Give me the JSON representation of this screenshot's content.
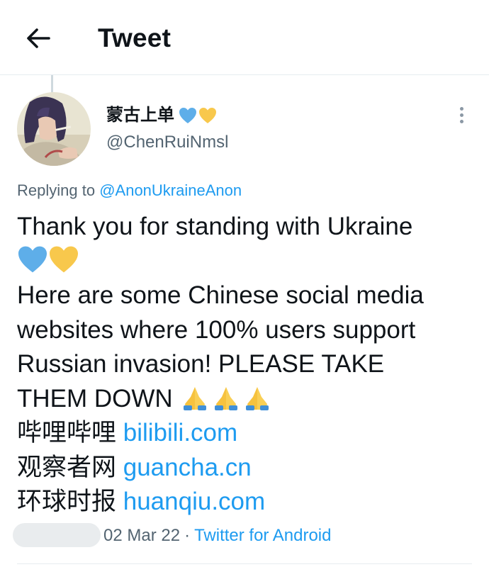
{
  "header": {
    "title": "Tweet",
    "back_icon": "arrow-left-icon"
  },
  "tweet": {
    "author": {
      "display_name": "蒙古上单",
      "name_emojis": [
        "blue-heart-icon",
        "yellow-heart-icon"
      ],
      "handle": "@ChenRuiNmsl"
    },
    "more_icon": "more-vertical-icon",
    "reply_prefix": "Replying to",
    "reply_mention": "@AnonUkraineAnon",
    "text_lines": [
      "Thank you for standing with Ukraine",
      "Here are some Chinese social media",
      "websites where 100% users support",
      "Russian invasion! PLEASE TAKE",
      "THEM DOWN"
    ],
    "line2_emojis": [
      "blue-heart-icon",
      "yellow-heart-icon"
    ],
    "line6_emojis": [
      "folded-hands-icon",
      "folded-hands-icon",
      "folded-hands-icon"
    ],
    "sites": [
      {
        "name": "哔哩哔哩",
        "url": "bilibili.com"
      },
      {
        "name": "观察者网",
        "url": "guancha.cn"
      },
      {
        "name": "环球时报",
        "url": "huanqiu.com"
      }
    ],
    "date": "02 Mar 22",
    "separator": "·",
    "source": "Twitter for Android"
  },
  "colors": {
    "link": "#1d9bf0",
    "secondary_text": "#536471",
    "primary_text": "#0f1419",
    "blue_heart": "#5eaee9",
    "yellow_heart": "#f8c84c"
  }
}
